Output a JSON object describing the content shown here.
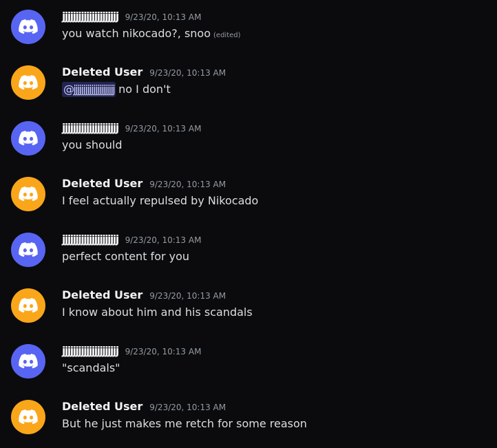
{
  "colors": {
    "background": "#0b0b0d",
    "avatar_blurple": "#5865f2",
    "avatar_orange": "#faa61a",
    "text": "#dbdee1",
    "author": "#f2f3f5",
    "timestamp": "#949ba4",
    "mention_bg": "#3a3f7a"
  },
  "messages": [
    {
      "author": "jjjjjjjjjjjjjjjjjjjjj",
      "avatar_icon": "discord-logo-icon",
      "avatar_color": "blurple",
      "timestamp": "9/23/20, 10:13 AM",
      "text": "you watch nikocado?, snoo",
      "edited": "(edited)"
    },
    {
      "author": "Deleted User",
      "avatar_icon": "discord-logo-icon",
      "avatar_color": "orange",
      "timestamp": "9/23/20, 10:13 AM",
      "mention": "@jjjjjjjjjjjjjjjjjjjjj",
      "text": "no I don't"
    },
    {
      "author": "jjjjjjjjjjjjjjjjjjjjj",
      "avatar_icon": "discord-logo-icon",
      "avatar_color": "blurple",
      "timestamp": "9/23/20, 10:13 AM",
      "text": "you should"
    },
    {
      "author": "Deleted User",
      "avatar_icon": "discord-logo-icon",
      "avatar_color": "orange",
      "timestamp": "9/23/20, 10:13 AM",
      "text": "I feel actually repulsed by Nikocado"
    },
    {
      "author": "jjjjjjjjjjjjjjjjjjjjj",
      "avatar_icon": "discord-logo-icon",
      "avatar_color": "blurple",
      "timestamp": "9/23/20, 10:13 AM",
      "text": "perfect content for you"
    },
    {
      "author": "Deleted User",
      "avatar_icon": "discord-logo-icon",
      "avatar_color": "orange",
      "timestamp": "9/23/20, 10:13 AM",
      "text": "I know about him and his scandals"
    },
    {
      "author": "jjjjjjjjjjjjjjjjjjjjj",
      "avatar_icon": "discord-logo-icon",
      "avatar_color": "blurple",
      "timestamp": "9/23/20, 10:13 AM",
      "text": "\"scandals\""
    },
    {
      "author": "Deleted User",
      "avatar_icon": "discord-logo-icon",
      "avatar_color": "orange",
      "timestamp": "9/23/20, 10:13 AM",
      "text": "But he just makes me retch for some reason"
    }
  ]
}
